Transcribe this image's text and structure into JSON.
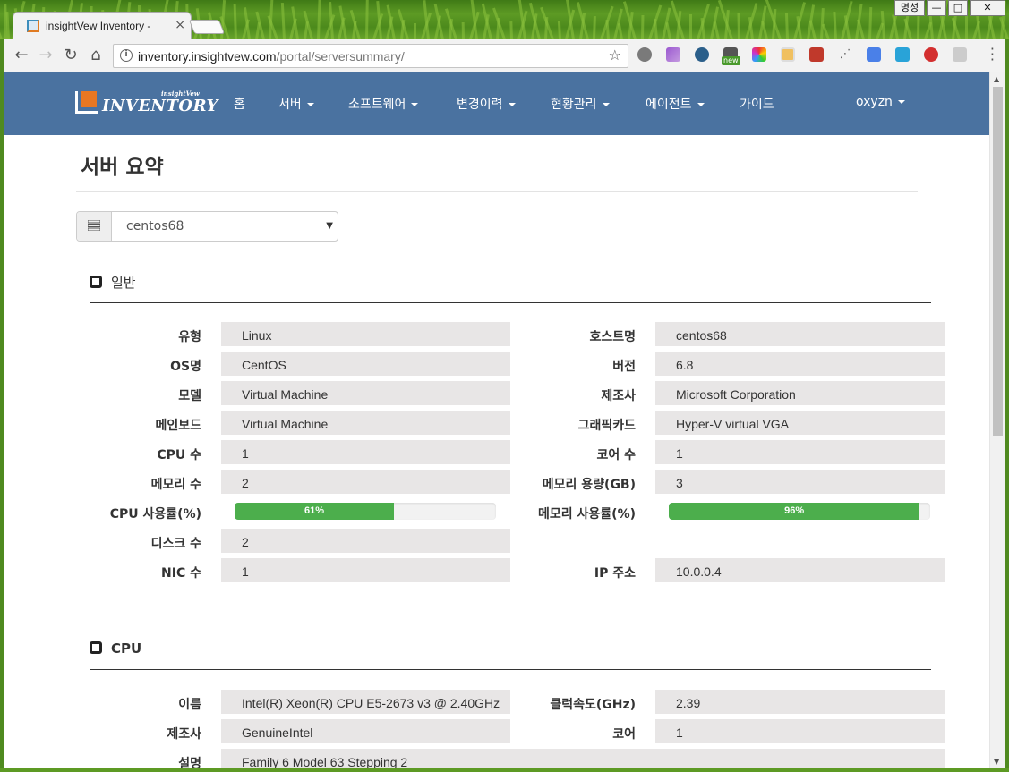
{
  "browser": {
    "tab_title": "insightVew Inventory -",
    "tab_close": "×",
    "window_user": "명성",
    "window_min": "—",
    "window_max": "□",
    "window_close": "✕",
    "url_host": "inventory.insightvew.com",
    "url_path": "/portal/serversummary/",
    "ext_new_badge": "new"
  },
  "navbar": {
    "logo_sub": "insightVew",
    "logo_main": "INVENTORY",
    "items": [
      "홈",
      "서버",
      "소프트웨어",
      "변경이력",
      "현황관리",
      "에이전트",
      "가이드"
    ],
    "user": "oxyzn"
  },
  "page": {
    "title": "서버 요약",
    "server_select": "centos68"
  },
  "general": {
    "heading": "일반",
    "left": [
      {
        "label": "유형",
        "value": "Linux"
      },
      {
        "label": "OS명",
        "value": "CentOS"
      },
      {
        "label": "모델",
        "value": "Virtual Machine"
      },
      {
        "label": "메인보드",
        "value": "Virtual Machine"
      },
      {
        "label": "CPU 수",
        "value": "1"
      },
      {
        "label": "메모리 수",
        "value": "2"
      },
      {
        "label": "CPU 사용률(%)",
        "value": "61%"
      },
      {
        "label": "디스크 수",
        "value": "2"
      },
      {
        "label": "NIC 수",
        "value": "1"
      }
    ],
    "right": [
      {
        "label": "호스트명",
        "value": "centos68"
      },
      {
        "label": "버전",
        "value": "6.8"
      },
      {
        "label": "제조사",
        "value": "Microsoft Corporation"
      },
      {
        "label": "그래픽카드",
        "value": "Hyper-V virtual VGA"
      },
      {
        "label": "코어 수",
        "value": "1"
      },
      {
        "label": "메모리 용량(GB)",
        "value": "3"
      },
      {
        "label": "메모리 사용률(%)",
        "value": "96%"
      },
      {
        "label": "IP 주소",
        "value": "10.0.0.4"
      }
    ],
    "cpu_usage_fraction": 0.61,
    "mem_usage_fraction": 0.96
  },
  "cpu": {
    "heading": "CPU",
    "rows": [
      {
        "label": "이름",
        "value": "Intel(R) Xeon(R) CPU E5-2673 v3 @ 2.40GHz",
        "label2": "클럭속도(GHz)",
        "value2": "2.39"
      },
      {
        "label": "제조사",
        "value": "GenuineIntel",
        "label2": "코어",
        "value2": "1"
      },
      {
        "label": "설명",
        "value": "Family 6 Model 63 Stepping 2"
      }
    ]
  },
  "colors": {
    "navbar": "#4a72a0",
    "progress": "#4cae4c",
    "cell": "#e8e6e6",
    "logo_accent": "#e87722"
  }
}
